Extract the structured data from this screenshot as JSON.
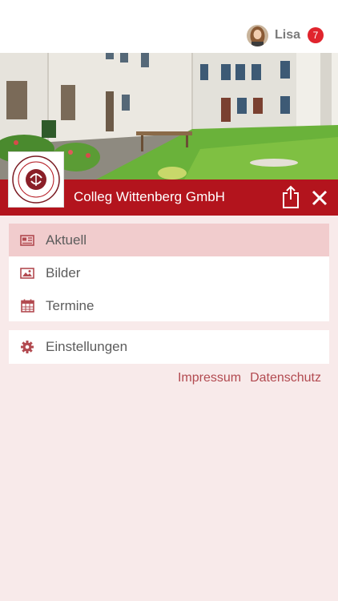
{
  "user": {
    "name": "Lisa",
    "notifications": "7"
  },
  "header": {
    "title": "Colleg Wittenberg GmbH"
  },
  "menu": {
    "main": [
      {
        "label": "Aktuell",
        "icon": "newspaper-icon",
        "active": true
      },
      {
        "label": "Bilder",
        "icon": "image-icon",
        "active": false
      },
      {
        "label": "Termine",
        "icon": "calendar-icon",
        "active": false
      }
    ],
    "settings": {
      "label": "Einstellungen",
      "icon": "gear-icon"
    }
  },
  "footer": {
    "impressum": "Impressum",
    "datenschutz": "Datenschutz"
  },
  "colors": {
    "accent": "#b3141d",
    "badge": "#e0242d",
    "background": "#f8eaea",
    "active_item": "#f1cccd",
    "link": "#b24a50"
  }
}
